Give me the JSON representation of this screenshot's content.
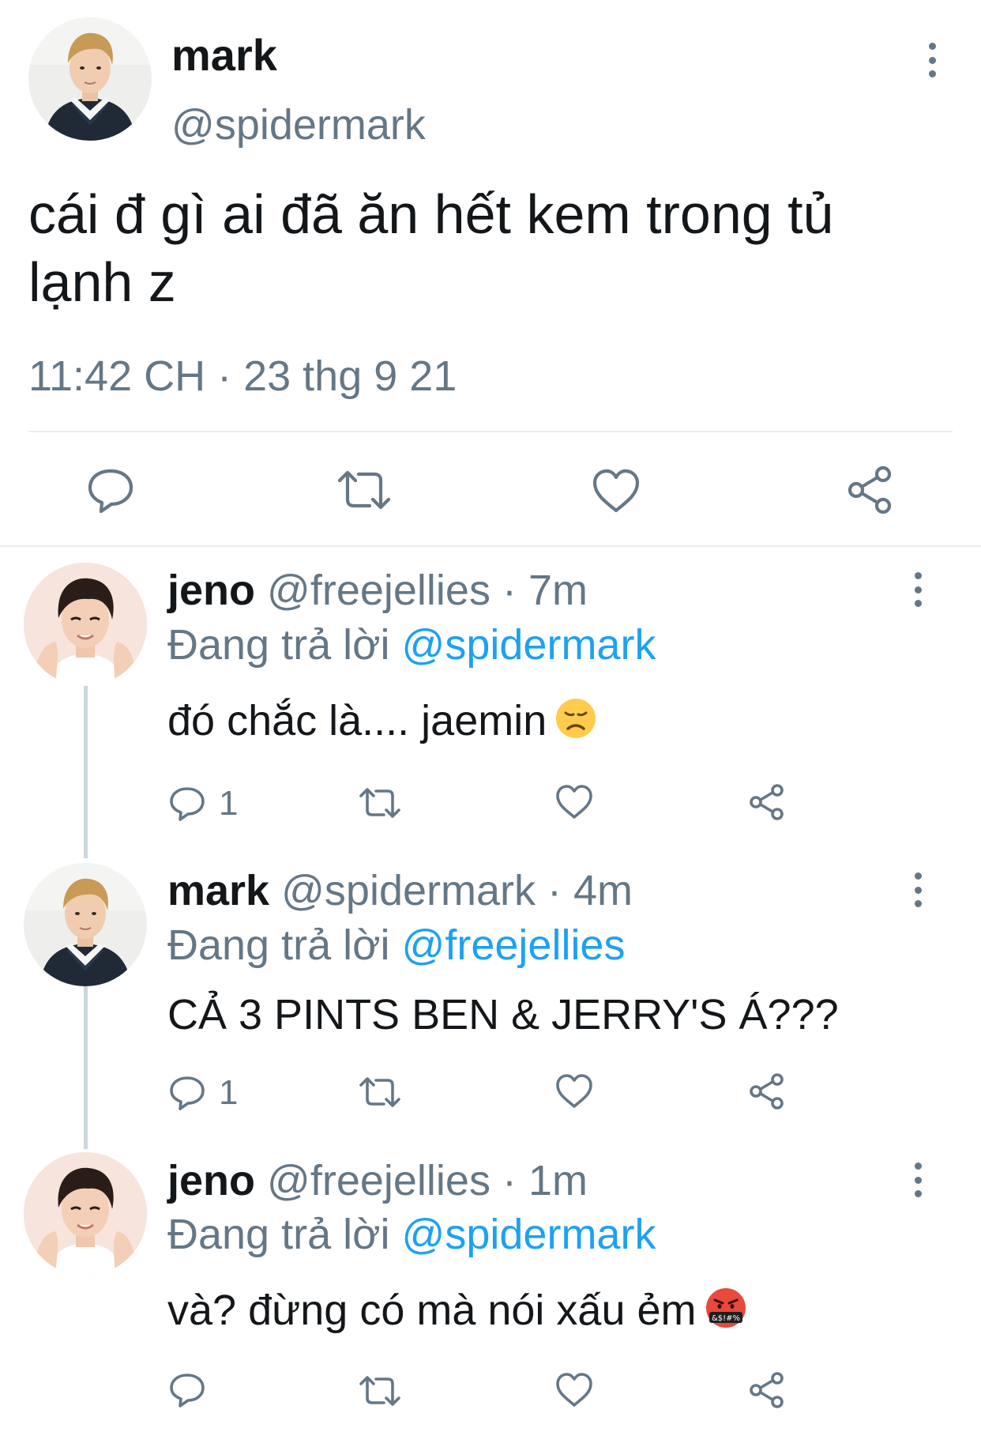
{
  "main_tweet": {
    "author_name": "mark",
    "author_handle": "@spidermark",
    "text": "cái đ gì ai đã ăn hết kem trong tủ lạnh z",
    "timestamp": "11:42 CH · 23 thg 9 21"
  },
  "actions": {
    "reply_icon": "reply-icon",
    "retweet_icon": "retweet-icon",
    "like_icon": "heart-icon",
    "share_icon": "share-icon",
    "more_icon": "more-vertical-icon"
  },
  "replies": [
    {
      "name": "jeno",
      "handle": "@freejellies",
      "separator": "·",
      "time": "7m",
      "replying_prefix": "Đang trả lời",
      "replying_to": "@spidermark",
      "text": "đó chắc là.... jaemin",
      "emoji": "disappointed-face-emoji",
      "reply_count": "1"
    },
    {
      "name": "mark",
      "handle": "@spidermark",
      "separator": "·",
      "time": "4m",
      "replying_prefix": "Đang trả lời",
      "replying_to": "@freejellies",
      "text": "CẢ 3 PINTS BEN & JERRY'S Á???",
      "reply_count": "1"
    },
    {
      "name": "jeno",
      "handle": "@freejellies",
      "separator": "·",
      "time": "1m",
      "replying_prefix": "Đang trả lời",
      "replying_to": "@spidermark",
      "text": "và? đừng có mà nói xấu ẻm",
      "emoji": "cursing-face-emoji",
      "emoji_text": "&$!#%",
      "reply_count": ""
    }
  ],
  "colors": {
    "text": "#14171a",
    "secondary": "#657786",
    "link": "#1da1f2",
    "divider": "#e6ecf0",
    "thread_line": "#ccd6dd"
  }
}
